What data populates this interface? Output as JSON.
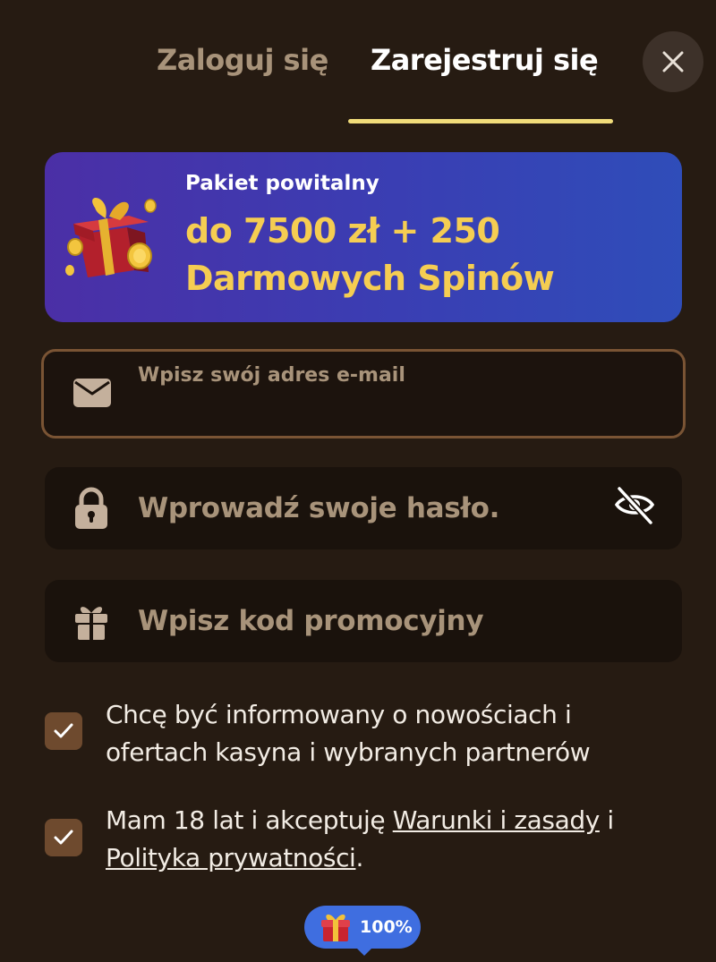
{
  "header": {
    "tab_login": "Zaloguj się",
    "tab_register": "Zarejestruj się",
    "active_tab": "Zarejestruj się",
    "accent_color": "#f0dc7a"
  },
  "banner": {
    "small": "Pakiet powitalny",
    "line1": "do 7500 zł + 250",
    "line2": "Darmowych Spinów",
    "icon": "gift-box-coins-icon"
  },
  "form": {
    "email_label": "Wpisz swój adres e-mail",
    "email_value": "",
    "password_placeholder": "Wprowadź swoje hasło.",
    "promo_placeholder": "Wpisz kod promocyjny"
  },
  "consents": {
    "newsletter_text": "Chcę być informowany o nowościach i ofertach kasyna i wybranych partnerów",
    "newsletter_checked": true,
    "terms_prefix": "Mam 18 lat i akceptuję ",
    "terms_link": "Warunki i zasady",
    "terms_join": " i ",
    "privacy_link": "Polityka prywatności",
    "terms_suffix": ".",
    "terms_checked": true
  },
  "badge": {
    "text": "100%",
    "icon": "gift-icon"
  }
}
